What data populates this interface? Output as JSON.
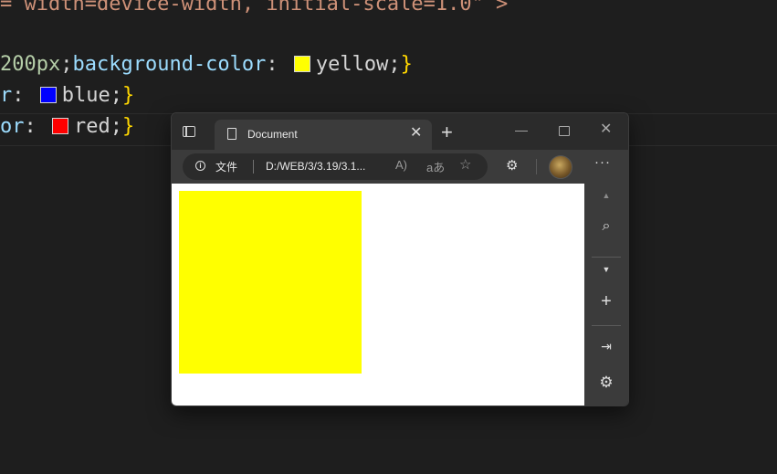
{
  "editor": {
    "line1": {
      "text": "= width=device-width, initial-scale=1.0\" >"
    },
    "line2": {
      "num": "200px",
      "semicolon": ";",
      "prop": "background-color",
      "colon": ":",
      "value": "yellow",
      "end": ";",
      "brace": "}"
    },
    "line3": {
      "prefix": "r",
      "colon": ":",
      "value": "blue",
      "end": ";",
      "brace": "}"
    },
    "line4": {
      "prefix": "or",
      "colon": ":",
      "value": "red",
      "end": ";",
      "brace": "}"
    },
    "swatch_colors": {
      "yellow": "#ffff00",
      "blue": "#0000ff",
      "red": "#ff0000"
    }
  },
  "browser": {
    "tab": {
      "title": "Document",
      "close_glyph": "✕"
    },
    "new_tab_glyph": "+",
    "window_controls": {
      "minimize": "—",
      "close": "✕"
    },
    "address_bar": {
      "site_info_label": "文件",
      "url": "D:/WEB/3/3.19/3.1...",
      "read_aloud_glyph": "A)",
      "translate_glyph": "aあ",
      "favorite_glyph": "☆"
    },
    "extensions_glyph": "⚙",
    "more_glyph": "···",
    "sidebar": {
      "scroll_up": "▲",
      "search": "⌕",
      "discover": "▼",
      "add": "+",
      "split": "⇥",
      "settings": "⚙"
    },
    "page": {
      "box_color": "#ffff00",
      "page_background": "#ffffff"
    }
  }
}
